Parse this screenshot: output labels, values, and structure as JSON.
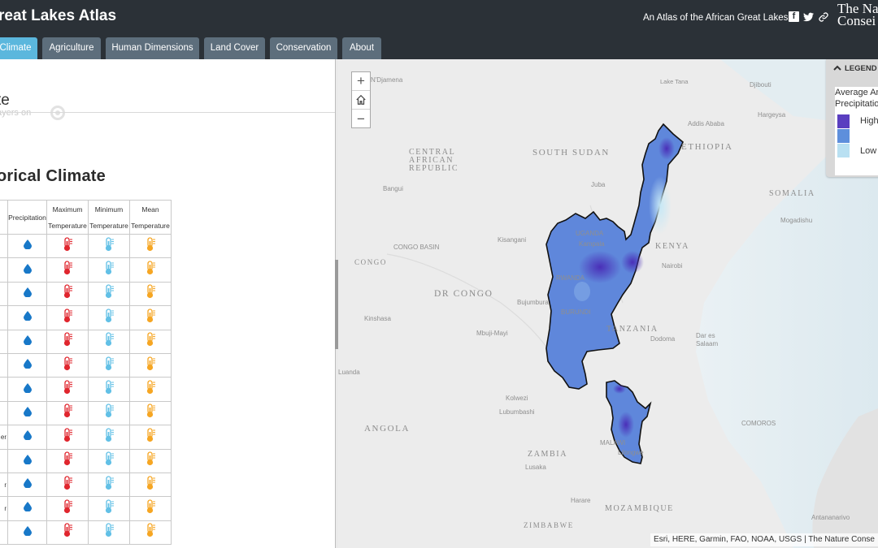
{
  "header": {
    "app_title": "reat Lakes Atlas",
    "tagline": "An Atlas of the African Great Lakes",
    "logo_line1": "The Na",
    "logo_line2": "Consei"
  },
  "tabs": [
    {
      "label": "Climate",
      "active": true
    },
    {
      "label": "Agriculture",
      "active": false
    },
    {
      "label": "Human Dimensions",
      "active": false
    },
    {
      "label": "Land Cover",
      "active": false
    },
    {
      "label": "Conservation",
      "active": false
    },
    {
      "label": "About",
      "active": false
    }
  ],
  "panel": {
    "title": "te",
    "layers_label": "ayers on",
    "section_heading": "orical Climate",
    "table_headers": [
      "Precipitation",
      "Maximum Temperature",
      "Minimum Temperature",
      "Mean Temperature"
    ],
    "month_fragments": [
      "",
      "",
      "",
      "",
      "",
      "",
      "",
      "",
      "er",
      "",
      "r",
      "r",
      ""
    ],
    "icon_colors": {
      "precip": "#1878c8",
      "max": "#e0262e",
      "min": "#62c0e6",
      "mean": "#f6a623"
    }
  },
  "map": {
    "labels": [
      {
        "text": "SOUTH SUDAN"
      },
      {
        "text": "CENTRAL"
      },
      {
        "text": "AFRICAN"
      },
      {
        "text": "REPUBLIC"
      },
      {
        "text": "ETHIOPIA"
      },
      {
        "text": "SOMALIA"
      },
      {
        "text": "KENYA"
      },
      {
        "text": "DR CONGO"
      },
      {
        "text": "CONGO"
      },
      {
        "text": "CONGO BASIN"
      },
      {
        "text": "TANZANIA"
      },
      {
        "text": "ANGOLA"
      },
      {
        "text": "ZAMBIA"
      },
      {
        "text": "MOZAMBIQUE"
      },
      {
        "text": "ZIMBABWE"
      },
      {
        "text": "COMOROS"
      },
      {
        "text": "UGANDA"
      },
      {
        "text": "RWANDA"
      },
      {
        "text": "BURUNDI"
      },
      {
        "text": "MALAWI"
      },
      {
        "text": "Addis Ababa"
      },
      {
        "text": "Djibouti"
      },
      {
        "text": "Hargeysa"
      },
      {
        "text": "Mogadishu"
      },
      {
        "text": "Juba"
      },
      {
        "text": "Bangui"
      },
      {
        "text": "Kisangani"
      },
      {
        "text": "Kampala"
      },
      {
        "text": "Nairobi"
      },
      {
        "text": "Bujumbura"
      },
      {
        "text": "Kinshasa"
      },
      {
        "text": "Mbuji-Mayi"
      },
      {
        "text": "Dodoma"
      },
      {
        "text": "Dar es"
      },
      {
        "text": "Salaam"
      },
      {
        "text": "Kolwezi"
      },
      {
        "text": "Lubumbashi"
      },
      {
        "text": "Lusaka"
      },
      {
        "text": "Lilongwe"
      },
      {
        "text": "Harare"
      },
      {
        "text": "Antananarivo"
      },
      {
        "text": "Luanda"
      },
      {
        "text": "N'Djamena"
      },
      {
        "text": "Lake Tana"
      }
    ],
    "attribution": "Esri, HERE, Garmin, FAO, NOAA, USGS | The Nature Conse",
    "zoom_in": "+",
    "zoom_out": "−"
  },
  "legend": {
    "header": "LEGEND",
    "layer_line1": "Average An",
    "layer_line2": "Precipitatio",
    "high": "High",
    "low": "Low",
    "colors": [
      "#5a3fc0",
      "#5e8fdc",
      "#b9e0f2"
    ]
  }
}
